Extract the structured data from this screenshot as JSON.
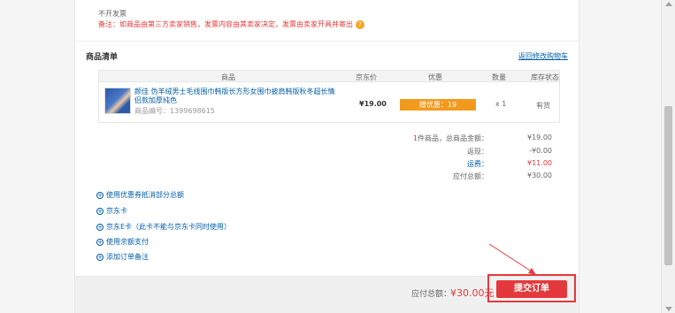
{
  "invoice": {
    "none": "不开发票",
    "note": "备注：如商品由第三方卖家销售，发票内容由其卖家决定，发票由卖家开具并寄出",
    "help_icon": "?"
  },
  "goods": {
    "title": "商品清单",
    "return_cart": "返回修改购物车",
    "columns": [
      "商品",
      "京东价",
      "优惠",
      "数量",
      "库存状态"
    ],
    "item": {
      "name": "颜佳 伪羊绒男士毛线围巾韩版长方形女围巾披肩韩版秋冬超长情侣款加厚纯色",
      "sku": "商品编号：1399698615",
      "price": "¥19.00",
      "discount": "赠优惠：19",
      "qty": "x 1",
      "stock": "有货"
    }
  },
  "summary": {
    "items_label": "件商品，总商品金额：",
    "items_count": "1",
    "items_total": "¥19.00",
    "rebate_label": "返现：",
    "rebate_value": "-¥0.00",
    "freight_label": "运费：",
    "freight_value": "¥11.00",
    "payable_label": "应付总额：",
    "payable_value": "¥30.00"
  },
  "options": [
    "使用优惠券抵消部分总额",
    "京东卡",
    "京东E卡（此卡不能与京东卡同时使用）",
    "使用余额支付",
    "添加订单备注"
  ],
  "bottom": {
    "total_label": "应付总额：",
    "total_value": "¥30.00元",
    "submit": "提交订单"
  },
  "colors": {
    "accent_red": "#e4393c",
    "link_blue": "#005ea7",
    "discount_orange": "#f29a1d"
  }
}
